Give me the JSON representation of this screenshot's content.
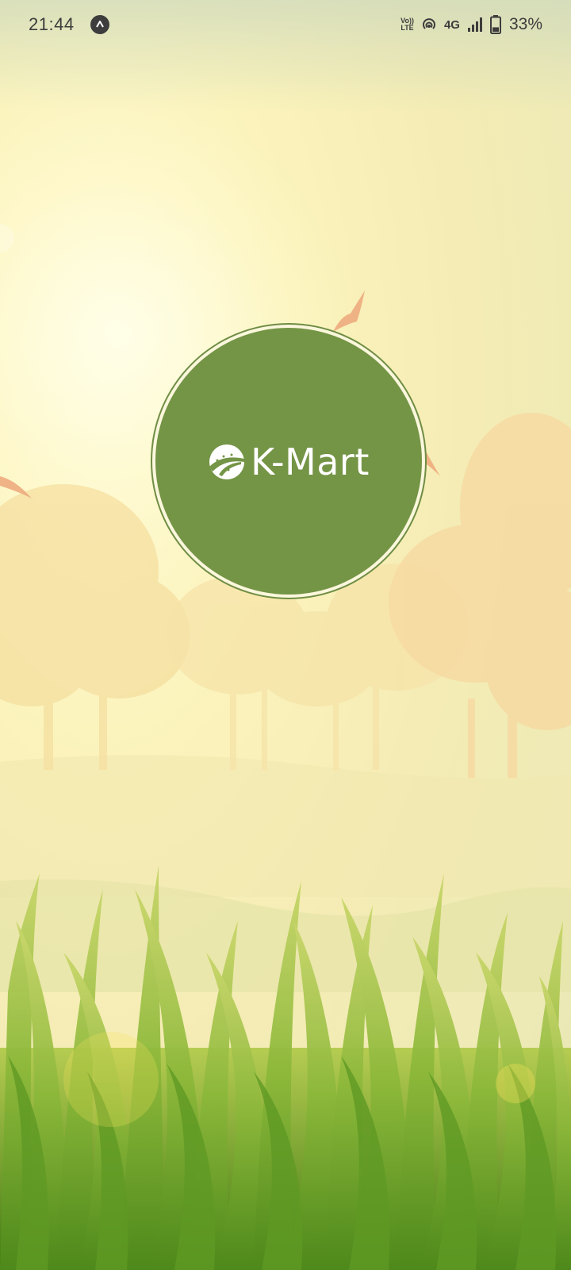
{
  "status_bar": {
    "time": "21:44",
    "volte_top": "Vo))",
    "volte_bottom": "LTE",
    "network_type": "4G",
    "battery_percent": "33%",
    "battery_level": 0.33,
    "icons": [
      "app-notification-icon",
      "volte-icon",
      "hotspot-icon",
      "signal-icon",
      "battery-icon"
    ]
  },
  "splash": {
    "brand_name": "K-Mart",
    "circle_color": "#749446",
    "logo_icon": "kmart-road-logo-icon"
  }
}
